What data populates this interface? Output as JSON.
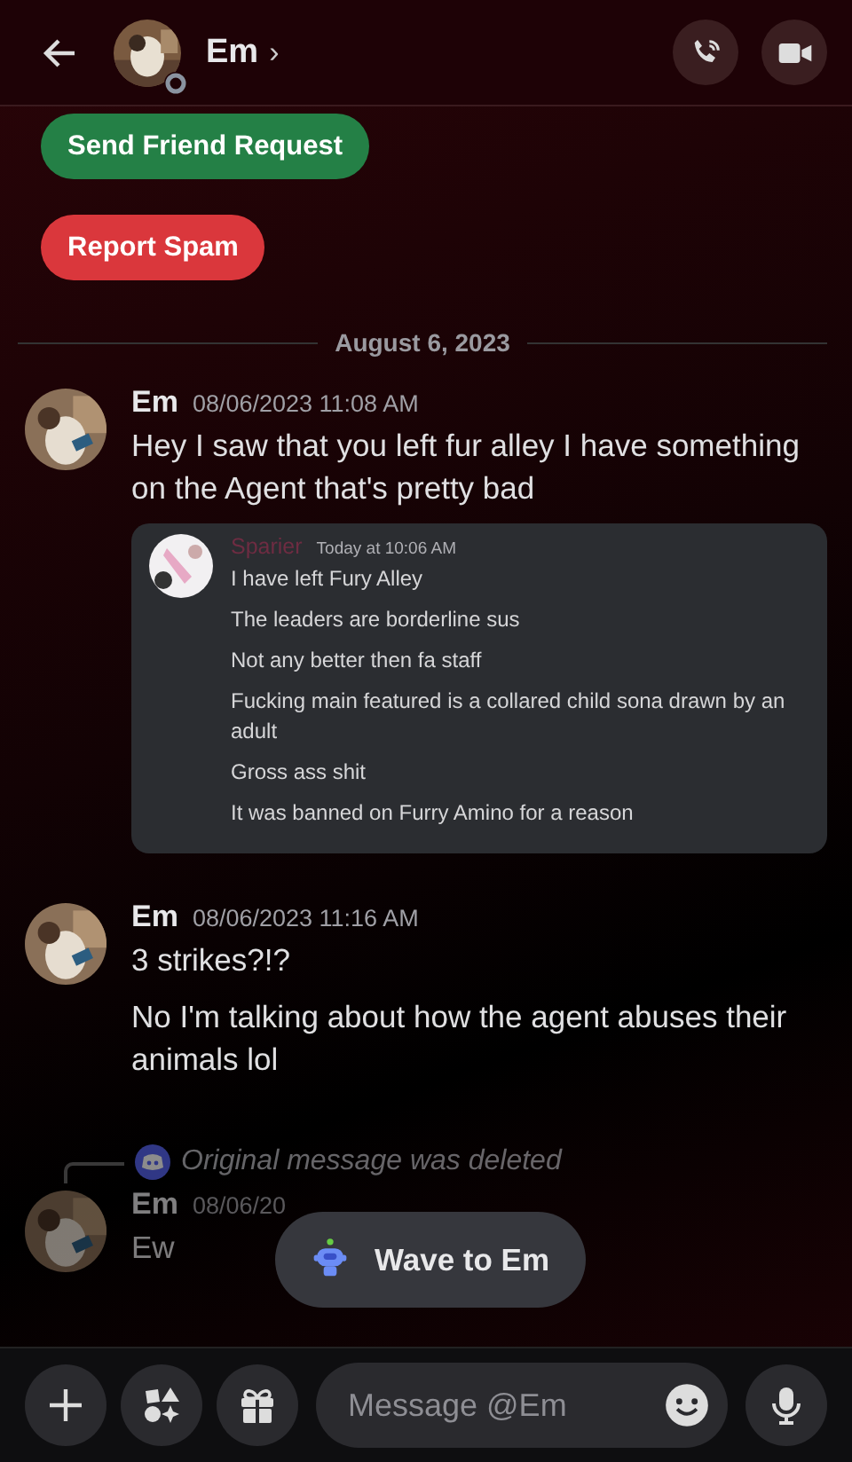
{
  "header": {
    "title": "Em",
    "chevron": "›"
  },
  "actions": [
    {
      "label": "Send Friend Request",
      "kind": "friend"
    },
    {
      "label": "Report Spam",
      "kind": "spam"
    }
  ],
  "date_divider": "August 6, 2023",
  "messages": [
    {
      "author": "Em",
      "timestamp": "08/06/2023 11:08 AM",
      "dimmed": false,
      "lines": [
        "Hey I saw that you left fur alley I have something on the Agent that's pretty bad"
      ],
      "embed": {
        "author": "Sparier",
        "timestamp": "Today at 10:06 AM",
        "lines": [
          "I have left Fury Alley",
          "The leaders are borderline sus",
          "Not any better then fa staff",
          "Fucking main featured is a collared child sona drawn by an adult",
          "Gross ass shit",
          "It was banned on Furry Amino for a reason"
        ]
      }
    },
    {
      "author": "Em",
      "timestamp": "08/06/2023 11:16 AM",
      "dimmed": false,
      "lines": [
        "3 strikes?!?",
        "No I'm talking about how the agent abuses their animals lol"
      ]
    },
    {
      "reply_ref": "Original message was deleted",
      "author": "Em",
      "timestamp": "08/06/20",
      "dimmed": true,
      "lines": [
        "Ew"
      ]
    }
  ],
  "wave_button": "Wave to Em",
  "composer": {
    "placeholder": "Message @Em"
  }
}
